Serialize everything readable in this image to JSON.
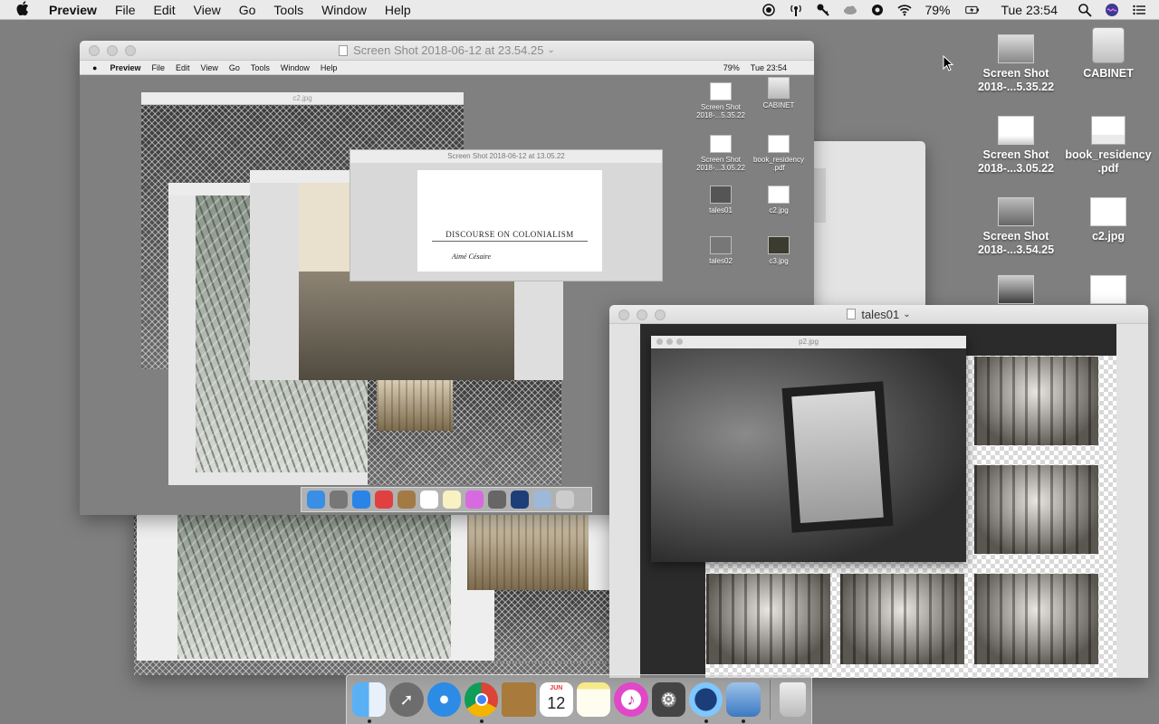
{
  "menubar": {
    "app_name": "Preview",
    "menus": [
      "File",
      "Edit",
      "View",
      "Go",
      "Tools",
      "Window",
      "Help"
    ],
    "battery": "79%",
    "clock": "Tue 23:54"
  },
  "windows": {
    "main_screenshot": {
      "title": "Screen Shot 2018-06-12 at 23.54.25",
      "inner_menubar": {
        "app_name": "Preview",
        "menus": [
          "File",
          "Edit",
          "View",
          "Go",
          "Tools",
          "Window",
          "Help"
        ],
        "battery": "79%",
        "clock": "Tue 23:54"
      },
      "inner_c2_title": "c2.jpg",
      "inner_screenshot_title": "Screen Shot 2018-06-12 at 13.05.22",
      "doc_heading": "DISCOURSE ON COLONIALISM",
      "doc_author": "Aimé Césaire",
      "mini_icons": [
        {
          "label": "Screen Shot 2018-...5.35.22"
        },
        {
          "label": "CABINET"
        },
        {
          "label": "Screen Shot 2018-...3.05.22"
        },
        {
          "label": "book_residency .pdf"
        },
        {
          "label": "tales01"
        },
        {
          "label": "c2.jpg"
        },
        {
          "label": "tales02"
        },
        {
          "label": "c3.jpg"
        }
      ]
    },
    "tales01": {
      "title": "tales01",
      "inner_title": "p2.jpg"
    }
  },
  "desktop_icons": [
    {
      "label": "Screen Shot 2018-...5.35.22",
      "kind": "screenshot"
    },
    {
      "label": "CABINET",
      "kind": "drive"
    },
    {
      "label": "Screen Shot 2018-...3.05.22",
      "kind": "screenshot"
    },
    {
      "label": "book_residency .pdf",
      "kind": "pdf"
    },
    {
      "label": "Screen Shot 2018-...3.54.25",
      "kind": "screenshot"
    },
    {
      "label": "c2.jpg",
      "kind": "image"
    }
  ],
  "dock": {
    "calendar_month": "JUN",
    "calendar_day": "12",
    "apps": [
      "finder",
      "launchpad",
      "safari",
      "chrome",
      "notefile",
      "calendar",
      "notes",
      "itunes",
      "system-preferences",
      "quicktime",
      "preview",
      "trash"
    ]
  },
  "colors": {
    "desktop": "#7f7f80",
    "menubar": "#eaeaea"
  }
}
